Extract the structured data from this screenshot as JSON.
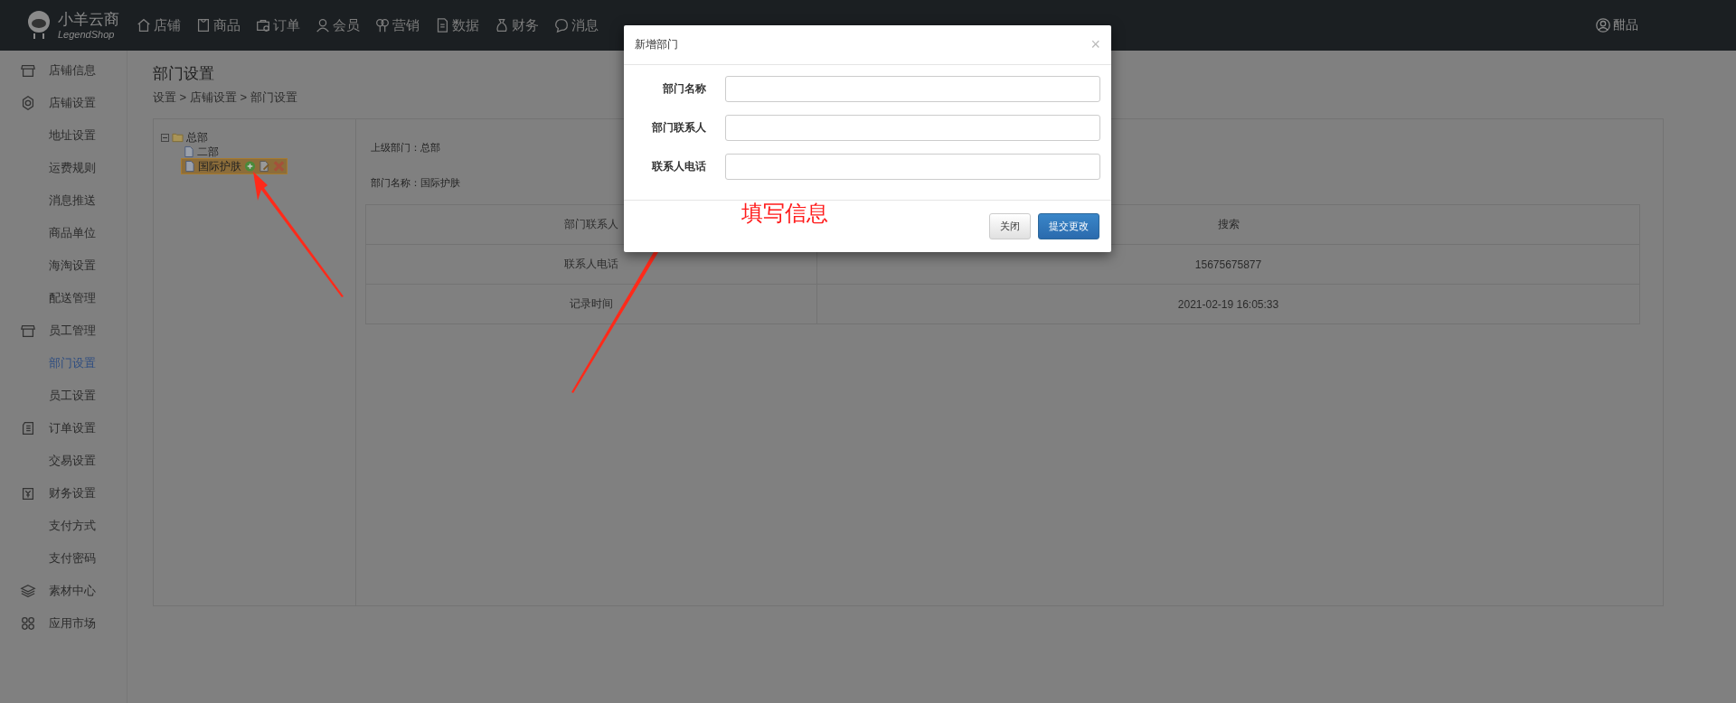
{
  "topbar": {
    "logo": {
      "title": "小羊云商",
      "subtitle": "LegendShop"
    },
    "items": [
      {
        "label": "店铺"
      },
      {
        "label": "商品"
      },
      {
        "label": "订单"
      },
      {
        "label": "会员"
      },
      {
        "label": "营销"
      },
      {
        "label": "数据"
      },
      {
        "label": "财务"
      },
      {
        "label": "消息"
      }
    ],
    "user": "酣品"
  },
  "sidebar": {
    "groups": [
      {
        "label": "店铺信息"
      },
      {
        "label": "店铺设置",
        "children": [
          {
            "label": "地址设置",
            "selected": false
          },
          {
            "label": "运费规则",
            "selected": false
          },
          {
            "label": "消息推送",
            "selected": false
          },
          {
            "label": "商品单位",
            "selected": false
          },
          {
            "label": "海淘设置",
            "selected": false
          },
          {
            "label": "配送管理",
            "selected": false
          }
        ]
      },
      {
        "label": "员工管理",
        "children": [
          {
            "label": "部门设置",
            "selected": true
          },
          {
            "label": "员工设置",
            "selected": false
          }
        ]
      },
      {
        "label": "订单设置",
        "children": [
          {
            "label": "交易设置",
            "selected": false
          }
        ]
      },
      {
        "label": "财务设置",
        "children": [
          {
            "label": "支付方式",
            "selected": false
          },
          {
            "label": "支付密码",
            "selected": false
          }
        ]
      },
      {
        "label": "素材中心"
      },
      {
        "label": "应用市场"
      }
    ]
  },
  "page": {
    "title": "部门设置",
    "breadcrumb": "设置 > 店铺设置 > 部门设置"
  },
  "tree": {
    "label": "总部",
    "expanded": true,
    "children": [
      {
        "label": "二部",
        "selected": false
      },
      {
        "label": "国际护肤",
        "selected": true
      }
    ]
  },
  "detail": {
    "lines": [
      "上级部门：总部",
      "部门名称：国际护肤"
    ],
    "table": {
      "rows": [
        [
          "部门联系人",
          "搜索"
        ],
        [
          "联系人电话",
          "15675675877"
        ],
        [
          "记录时间",
          "2021-02-19 16:05:33"
        ]
      ]
    }
  },
  "modal": {
    "title": "新增部门",
    "close": "×",
    "fields": [
      {
        "label": "部门名称"
      },
      {
        "label": "部门联系人"
      },
      {
        "label": "联系人电话"
      }
    ],
    "buttons": [
      {
        "label": "关闭",
        "kind": "default"
      },
      {
        "label": "提交更改",
        "kind": "primary"
      }
    ]
  },
  "annotation": {
    "text": "填写信息"
  }
}
